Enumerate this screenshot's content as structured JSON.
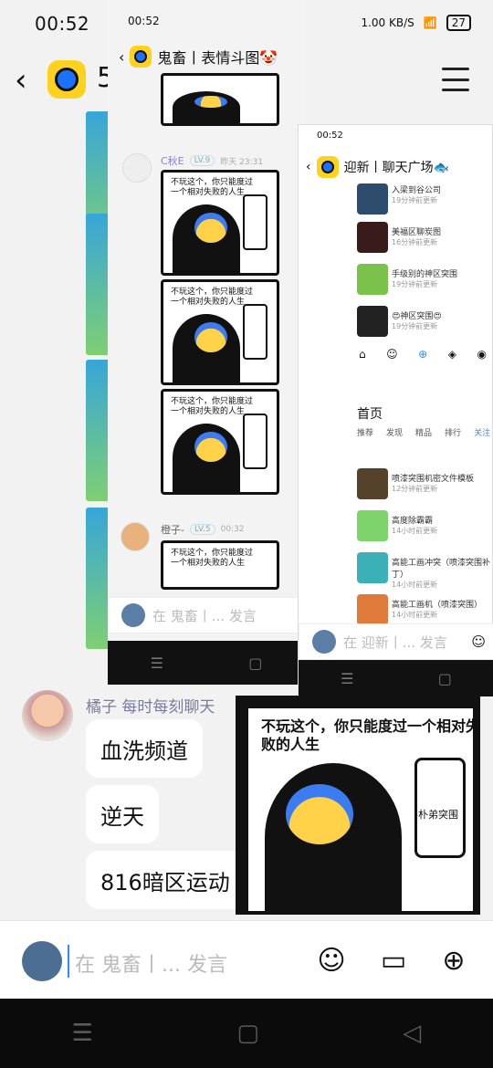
{
  "status": {
    "time": "00:52",
    "net": "1.00 KB/S",
    "battery": "27"
  },
  "header": {
    "title_fragment": "5"
  },
  "window1": {
    "time": "00:52",
    "title": "鬼畜丨表情斗图🤡",
    "user1": {
      "name": "C秋E",
      "level": "LV.9",
      "time": "昨天 23:31"
    },
    "user2": {
      "name": "橙子-",
      "level": "LV.5",
      "time": "00:32"
    },
    "meme_caption": "不玩这个，你只能度过一个相对失败的人生",
    "meme_phone": "朴弟突围",
    "input_placeholder": "在 鬼畜丨... 发言"
  },
  "window2": {
    "time": "00:52",
    "title": "迎新丨聊天广场🐟",
    "items": [
      {
        "title": "入梁到谷公司",
        "sub": "19分钟前更新"
      },
      {
        "title": "美福区聊炭图",
        "sub": "16分钟前更新"
      },
      {
        "title": "手级别的神区突围",
        "sub": "19分钟前更新"
      },
      {
        "title": "😍神区突围😍",
        "sub": "19分钟前更新"
      }
    ],
    "home_title": "首页",
    "tabs": [
      "推荐",
      "发现",
      "精品",
      "排行",
      "关注"
    ],
    "items2": [
      {
        "title": "喷漆突围机密文件模板",
        "sub": "12分钟前更新"
      },
      {
        "title": "高度除霸霸",
        "sub": "14小时前更新"
      },
      {
        "title": "高能工画冲突（喷漆突围补丁）",
        "sub": "14小时前更新"
      },
      {
        "title": "高能工画机（喷漆突围）",
        "sub": "14小时前更新"
      }
    ],
    "input_placeholder": "在 迎新丨... 发言"
  },
  "chat": {
    "sender": "橘子 每时每刻聊天",
    "messages": [
      "血洗频道",
      "逆天",
      "816暗区运动"
    ],
    "meme_caption": "不玩这个，你只能度过一个相对失败的人生",
    "meme_phone": "朴弟突围"
  },
  "input": {
    "placeholder": "在 鬼畜丨... 发言"
  }
}
